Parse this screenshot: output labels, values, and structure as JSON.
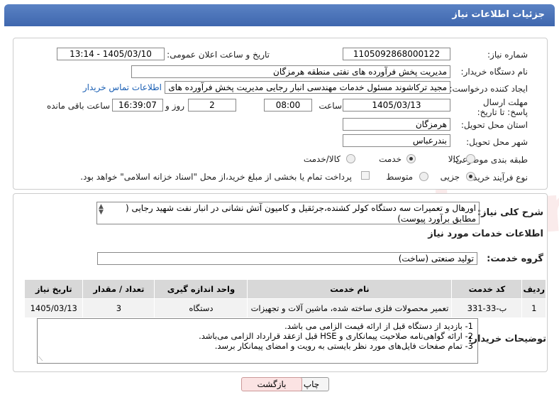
{
  "header": {
    "title": "جزئیات اطلاعات نیاز"
  },
  "form": {
    "need_number_label": "شماره نیاز:",
    "need_number": "1105092868000122",
    "announce_label": "تاریخ و ساعت اعلان عمومی:",
    "announce_value": "1405/03/10 - 13:14",
    "buyer_org_label": "نام دستگاه خریدار:",
    "buyer_org": "مدیریت پخش فرآورده های نفتی منطقه هرمزگان",
    "creator_label": "ایجاد کننده درخواست:",
    "creator": "مجید ترکاشوند مسئول خدمات مهندسی انبار رجایی مدیریت پخش فرآورده های",
    "contact_link": "اطلاعات تماس خریدار",
    "deadline_label": "مهلت ارسال پاسخ: تا تاریخ:",
    "deadline_date": "1405/03/13",
    "time_label": "ساعت",
    "deadline_time": "08:00",
    "days_value": "2",
    "days_label": "روز و",
    "remaining_time": "16:39:07",
    "remaining_label": "ساعت باقی مانده",
    "province_label": "استان محل تحویل:",
    "province": "هرمزگان",
    "city_label": "شهر محل تحویل:",
    "city": "بندرعباس",
    "category_label": "طبقه بندی موضوعی:",
    "category_options": [
      "کالا",
      "خدمت",
      "کالا/خدمت"
    ],
    "category_selected": "خدمت",
    "process_label": "نوع فرآیند خرید :",
    "process_options": [
      "جزیی",
      "متوسط"
    ],
    "payment_note": "پرداخت تمام یا بخشی از مبلغ خرید،از محل \"اسناد خزانه اسلامی\" خواهد بود."
  },
  "description": {
    "label": "شرح کلی نیاز:",
    "text": "اورهال و تعمیرات سه دستگاه کولر کشنده،جرثقیل و کامیون آتش نشانی در انبار نفت شهید رجایی ( مطابق برآورد پیوست)"
  },
  "services": {
    "section_title": "اطلاعات خدمات مورد نیاز",
    "group_label": "گروه خدمت:",
    "group_value": "تولید صنعتی (ساخت)",
    "columns": [
      "ردیف",
      "کد خدمت",
      "نام خدمت",
      "واحد اندازه گیری",
      "تعداد / مقدار",
      "تاریخ نیاز"
    ],
    "rows": [
      {
        "row": "1",
        "code": "ب-33-331",
        "name": "تعمیر محصولات فلزی ساخته شده، ماشین آلات و تجهیزات",
        "unit": "دستگاه",
        "qty": "3",
        "date": "1405/03/13"
      }
    ]
  },
  "notes": {
    "label": "توضیحات خریدار:",
    "lines": [
      "1-    بازدید از دستگاه قبل از ارائه قیمت الزامی می باشد.",
      "2-    ارائه گواهی‌نامه صلاحیت پیمانکاری و HSE  قبل ازعقد قرارداد الزامی می‌باشد.",
      "3-    تمام صفحات فایل‌های مورد نظر بایستی به رویت و امضای پیمانکار برسد."
    ]
  },
  "buttons": {
    "print": "چاپ",
    "back": "بازگشت"
  },
  "watermark": "AriaTender.neT"
}
